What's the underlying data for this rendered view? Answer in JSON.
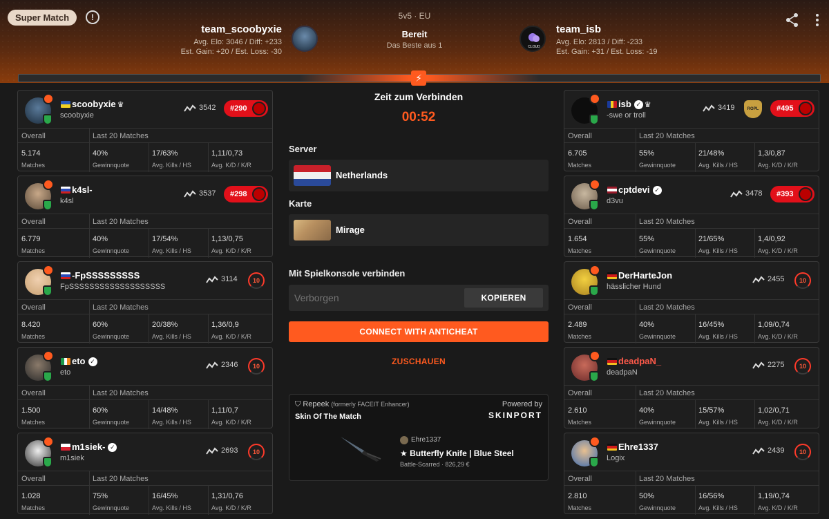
{
  "header": {
    "badge": "Super Match",
    "info": "!",
    "mode": "5v5 · EU",
    "status": "Bereit",
    "format": "Das Beste aus 1",
    "team_left": {
      "name": "team_scoobyxie",
      "line1": "Avg. Elo: 3046 / Diff: +233",
      "line2": "Est. Gain: +20 / Est. Loss: -30"
    },
    "team_right": {
      "name": "team_isb",
      "line1": "Avg. Elo: 2813 / Diff: -233",
      "line2": "Est. Gain: +31 / Est. Loss: -19",
      "avatar_text": "CLOUD"
    }
  },
  "stat_labels": {
    "overall": "Overall",
    "last20": "Last 20 Matches",
    "matches": "Matches",
    "winrate": "Gewinnquote",
    "kills": "Avg. Kills / HS",
    "kd": "Avg. K/D / K/R"
  },
  "players_left": [
    {
      "name": "scoobyxie",
      "sub": "scoobyxie",
      "flag": "ukraine",
      "crown": true,
      "verified": false,
      "elo": "3542",
      "pill": "#290",
      "level": null,
      "stats": [
        "5.174",
        "40%",
        "17/63%",
        "1,11/0,73"
      ]
    },
    {
      "name": "k4sl-",
      "sub": "k4sl",
      "flag": "russia",
      "crown": false,
      "verified": false,
      "elo": "3537",
      "pill": "#298",
      "level": null,
      "stats": [
        "6.779",
        "40%",
        "17/54%",
        "1,13/0,75"
      ]
    },
    {
      "name": "-FpSSSSSSSSS",
      "sub": "FpSSSSSSSSSSSSSSSSSSS",
      "flag": "russia",
      "crown": false,
      "verified": false,
      "elo": "3114",
      "pill": null,
      "level": "10",
      "stats": [
        "8.420",
        "60%",
        "20/38%",
        "1,36/0,9"
      ]
    },
    {
      "name": "eto",
      "sub": "eto",
      "flag": "ireland",
      "crown": false,
      "verified": true,
      "elo": "2346",
      "pill": null,
      "level": "10",
      "stats": [
        "1.500",
        "60%",
        "14/48%",
        "1,11/0,7"
      ]
    },
    {
      "name": "m1siek-",
      "sub": "m1siek",
      "flag": "poland",
      "crown": false,
      "verified": true,
      "elo": "2693",
      "pill": null,
      "level": "10",
      "stats": [
        "1.028",
        "75%",
        "16/45%",
        "1,31/0,76"
      ]
    }
  ],
  "players_right": [
    {
      "name": "isb",
      "sub": "-swe or troll",
      "flag": "romania",
      "crown": true,
      "verified": true,
      "elo": "3419",
      "pill": "#495",
      "level": null,
      "emblem": "ROPL",
      "stats": [
        "6.705",
        "55%",
        "21/48%",
        "1,3/0,87"
      ]
    },
    {
      "name": "cptdevi",
      "sub": "d3vu",
      "flag": "latvia",
      "crown": false,
      "verified": true,
      "elo": "3478",
      "pill": "#393",
      "level": null,
      "stats": [
        "1.654",
        "55%",
        "21/65%",
        "1,4/0,92"
      ]
    },
    {
      "name": "DerHarteJon",
      "sub": "hässlicher Hund",
      "flag": "germany",
      "crown": false,
      "verified": false,
      "elo": "2455",
      "pill": null,
      "level": "10",
      "stats": [
        "2.489",
        "40%",
        "16/45%",
        "1,09/0,74"
      ]
    },
    {
      "name": "deadpaN_",
      "sub": "deadpaN",
      "flag": "germany",
      "crown": false,
      "verified": false,
      "red": true,
      "elo": "2275",
      "pill": null,
      "level": "10",
      "stats": [
        "2.610",
        "40%",
        "15/57%",
        "1,02/0,71"
      ]
    },
    {
      "name": "Ehre1337",
      "sub": "Logix",
      "flag": "germany",
      "crown": false,
      "verified": false,
      "elo": "2439",
      "pill": null,
      "level": "10",
      "stats": [
        "2.810",
        "50%",
        "16/56%",
        "1,19/0,74"
      ]
    }
  ],
  "center": {
    "connect_title": "Zeit zum Verbinden",
    "timer": "00:52",
    "server_label": "Server",
    "server": "Netherlands",
    "map_label": "Karte",
    "map": "Mirage",
    "console_label": "Mit Spielkonsole verbinden",
    "console_placeholder": "Verborgen",
    "copy": "KOPIEREN",
    "anticheat": "CONNECT WITH ANTICHEAT",
    "watch": "ZUSCHAUEN"
  },
  "skin": {
    "source": "Repeek",
    "source_note": "(formerly FACEIT Enhancer)",
    "title": "Skin Of The Match",
    "powered_by": "Powered by",
    "powered_logo": "SKINPORT",
    "owner": "Ehre1337",
    "name": "★ Butterfly Knife | Blue Steel",
    "wear": "Battle-Scarred · 826,29 €"
  },
  "colors": {
    "accent": "#ff5a1f",
    "elo_pill": "#e2101a",
    "verified_green": "#2aa84a"
  }
}
